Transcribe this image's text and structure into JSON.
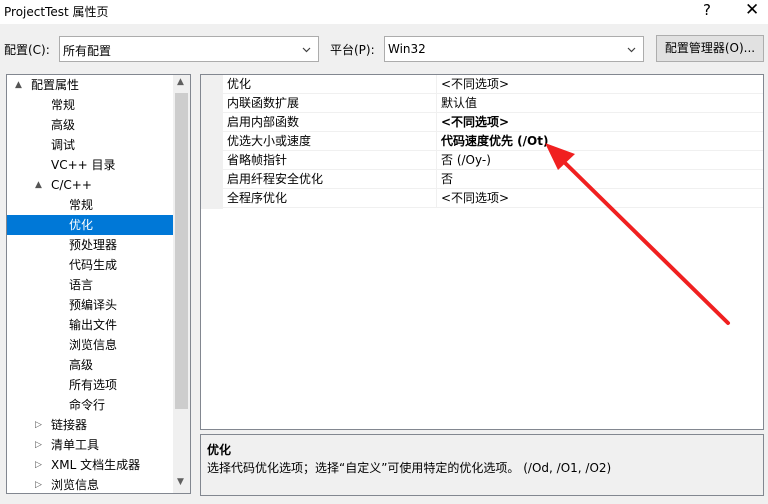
{
  "window": {
    "title": "ProjectTest 属性页",
    "help_glyph": "?",
    "close_glyph": "✕"
  },
  "config": {
    "config_label": "配置(C):",
    "config_value": "所有配置",
    "platform_label": "平台(P):",
    "platform_value": "Win32",
    "manager_button": "配置管理器(O)..."
  },
  "tree": {
    "items": [
      {
        "label": "配置属性",
        "expander": "▲"
      },
      {
        "label": "常规"
      },
      {
        "label": "高级"
      },
      {
        "label": "调试"
      },
      {
        "label": "VC++ 目录"
      },
      {
        "label": "C/C++",
        "expander": "▲"
      },
      {
        "label": "常规"
      },
      {
        "label": "优化",
        "selected": true
      },
      {
        "label": "预处理器"
      },
      {
        "label": "代码生成"
      },
      {
        "label": "语言"
      },
      {
        "label": "预编译头"
      },
      {
        "label": "输出文件"
      },
      {
        "label": "浏览信息"
      },
      {
        "label": "高级"
      },
      {
        "label": "所有选项"
      },
      {
        "label": "命令行"
      },
      {
        "label": "链接器",
        "expander": "▷"
      },
      {
        "label": "清单工具",
        "expander": "▷"
      },
      {
        "label": "XML 文档生成器",
        "expander": "▷"
      },
      {
        "label": "浏览信息",
        "expander": "▷"
      }
    ]
  },
  "properties": [
    {
      "name": "优化",
      "value": "<不同选项>",
      "bold": false
    },
    {
      "name": "内联函数扩展",
      "value": "默认值",
      "bold": false
    },
    {
      "name": "启用内部函数",
      "value": "<不同选项>",
      "bold": true
    },
    {
      "name": "优选大小或速度",
      "value": "代码速度优先 (/Ot)",
      "bold": true
    },
    {
      "name": "省略帧指针",
      "value": "否 (/Oy-)",
      "bold": false
    },
    {
      "name": "启用纤程安全优化",
      "value": "否",
      "bold": false
    },
    {
      "name": "全程序优化",
      "value": "<不同选项>",
      "bold": false
    }
  ],
  "description": {
    "title": "优化",
    "text": "选择代码优化选项；选择“自定义”可使用特定的优化选项。     (/Od, /O1, /O2)"
  },
  "colors": {
    "selection": "#0078d7",
    "annotation_arrow": "#f02020"
  },
  "icons": {
    "dropdown": "chevron-down-icon",
    "scroll_up": "scroll-up-icon",
    "scroll_down": "scroll-down-icon"
  }
}
